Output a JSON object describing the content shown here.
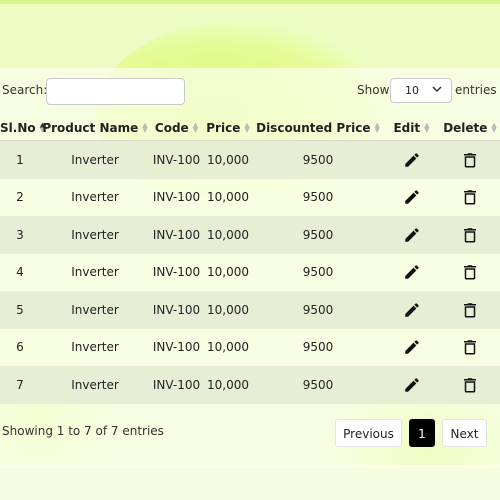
{
  "toolbar": {
    "search_label": "Search:",
    "search_value": "",
    "show_label": "Show",
    "page_size": "10",
    "entries_label": "entries"
  },
  "columns": [
    "Sl.No",
    "Product Name",
    "Code",
    "Price",
    "Discounted Price",
    "Edit",
    "Delete"
  ],
  "rows": [
    {
      "sl": "1",
      "product": "Inverter",
      "code": "INV-100",
      "price": "10,000",
      "discounted": "9500"
    },
    {
      "sl": "2",
      "product": "Inverter",
      "code": "INV-100",
      "price": "10,000",
      "discounted": "9500"
    },
    {
      "sl": "3",
      "product": "Inverter",
      "code": "INV-100",
      "price": "10,000",
      "discounted": "9500"
    },
    {
      "sl": "4",
      "product": "Inverter",
      "code": "INV-100",
      "price": "10,000",
      "discounted": "9500"
    },
    {
      "sl": "5",
      "product": "Inverter",
      "code": "INV-100",
      "price": "10,000",
      "discounted": "9500"
    },
    {
      "sl": "6",
      "product": "Inverter",
      "code": "INV-100",
      "price": "10,000",
      "discounted": "9500"
    },
    {
      "sl": "7",
      "product": "Inverter",
      "code": "INV-100",
      "price": "10,000",
      "discounted": "9500"
    }
  ],
  "footer": {
    "info": "Showing 1 to 7 of 7 entries",
    "previous": "Previous",
    "current_page": "1",
    "next": "Next"
  },
  "icons": {
    "edit": "pencil-icon",
    "delete": "trash-icon",
    "select": "chevron-down-icon"
  },
  "colors": {
    "background": "#eefcc4",
    "accent": "#d9f86a",
    "active_page": "#000000"
  }
}
